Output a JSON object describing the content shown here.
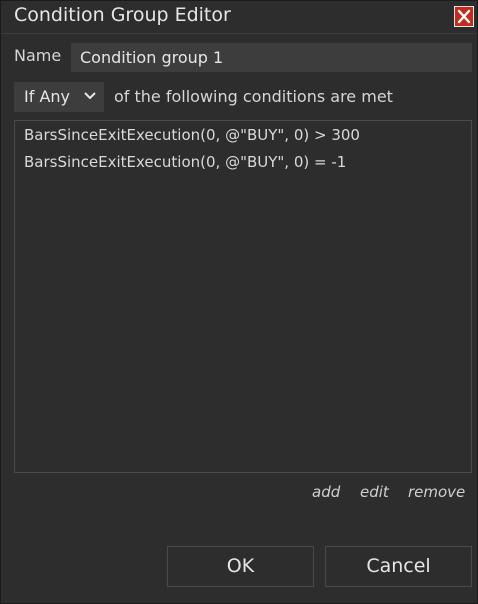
{
  "window": {
    "title": "Condition Group Editor",
    "close_icon": "close-icon"
  },
  "name": {
    "label": "Name",
    "value": "Condition group 1"
  },
  "mode": {
    "selected": "If Any",
    "suffix": "of the following conditions are met"
  },
  "conditions": [
    "BarsSinceExitExecution(0, @\"BUY\", 0) > 300",
    "BarsSinceExitExecution(0, @\"BUY\", 0) = -1"
  ],
  "actions": {
    "add": "add",
    "edit": "edit",
    "remove": "remove"
  },
  "buttons": {
    "ok": "OK",
    "cancel": "Cancel"
  },
  "colors": {
    "background": "#2d2d2d",
    "input": "#3d3d3d",
    "close": "#c42b1c"
  }
}
